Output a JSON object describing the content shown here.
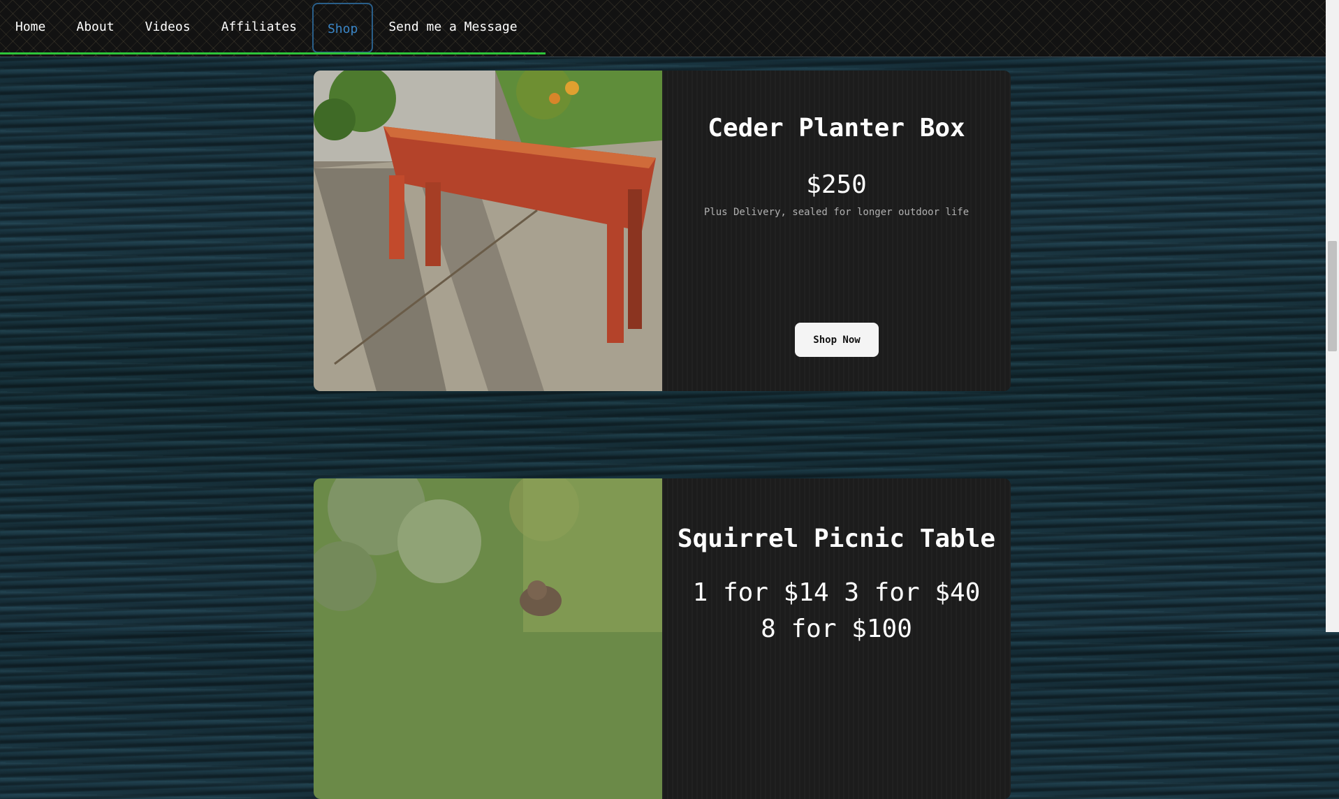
{
  "nav": {
    "items": [
      {
        "label": "Home"
      },
      {
        "label": "About"
      },
      {
        "label": "Videos"
      },
      {
        "label": "Affiliates"
      },
      {
        "label": "Shop",
        "active": true
      },
      {
        "label": "Send me a Message"
      }
    ],
    "underline_color": "#2ec43a",
    "active_color": "#3a86c8"
  },
  "products": [
    {
      "title": "Ceder Planter Box",
      "price": "$250",
      "note": "Plus Delivery, sealed for longer outdoor life",
      "button": "Shop Now",
      "image": "cedar-planter-box-photo"
    },
    {
      "title": "Squirrel Picnic Table",
      "price": "1 for $14 3 for $40 8 for $100",
      "image": "squirrel-photo"
    }
  ]
}
